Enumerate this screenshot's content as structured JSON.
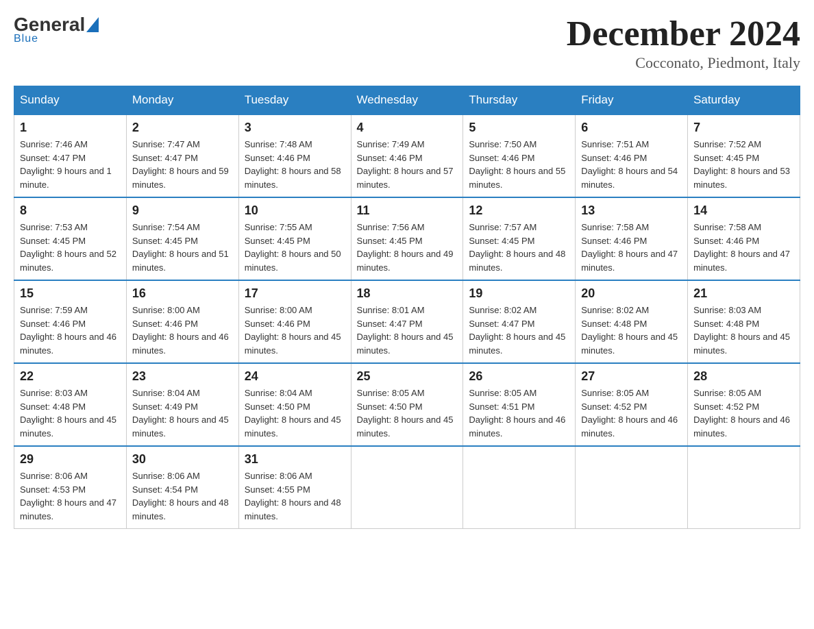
{
  "logo": {
    "general": "General",
    "blue": "Blue",
    "underline": "Blue"
  },
  "header": {
    "title": "December 2024",
    "location": "Cocconato, Piedmont, Italy"
  },
  "days_of_week": [
    "Sunday",
    "Monday",
    "Tuesday",
    "Wednesday",
    "Thursday",
    "Friday",
    "Saturday"
  ],
  "weeks": [
    [
      {
        "num": "1",
        "sunrise": "7:46 AM",
        "sunset": "4:47 PM",
        "daylight": "9 hours and 1 minute."
      },
      {
        "num": "2",
        "sunrise": "7:47 AM",
        "sunset": "4:47 PM",
        "daylight": "8 hours and 59 minutes."
      },
      {
        "num": "3",
        "sunrise": "7:48 AM",
        "sunset": "4:46 PM",
        "daylight": "8 hours and 58 minutes."
      },
      {
        "num": "4",
        "sunrise": "7:49 AM",
        "sunset": "4:46 PM",
        "daylight": "8 hours and 57 minutes."
      },
      {
        "num": "5",
        "sunrise": "7:50 AM",
        "sunset": "4:46 PM",
        "daylight": "8 hours and 55 minutes."
      },
      {
        "num": "6",
        "sunrise": "7:51 AM",
        "sunset": "4:46 PM",
        "daylight": "8 hours and 54 minutes."
      },
      {
        "num": "7",
        "sunrise": "7:52 AM",
        "sunset": "4:45 PM",
        "daylight": "8 hours and 53 minutes."
      }
    ],
    [
      {
        "num": "8",
        "sunrise": "7:53 AM",
        "sunset": "4:45 PM",
        "daylight": "8 hours and 52 minutes."
      },
      {
        "num": "9",
        "sunrise": "7:54 AM",
        "sunset": "4:45 PM",
        "daylight": "8 hours and 51 minutes."
      },
      {
        "num": "10",
        "sunrise": "7:55 AM",
        "sunset": "4:45 PM",
        "daylight": "8 hours and 50 minutes."
      },
      {
        "num": "11",
        "sunrise": "7:56 AM",
        "sunset": "4:45 PM",
        "daylight": "8 hours and 49 minutes."
      },
      {
        "num": "12",
        "sunrise": "7:57 AM",
        "sunset": "4:45 PM",
        "daylight": "8 hours and 48 minutes."
      },
      {
        "num": "13",
        "sunrise": "7:58 AM",
        "sunset": "4:46 PM",
        "daylight": "8 hours and 47 minutes."
      },
      {
        "num": "14",
        "sunrise": "7:58 AM",
        "sunset": "4:46 PM",
        "daylight": "8 hours and 47 minutes."
      }
    ],
    [
      {
        "num": "15",
        "sunrise": "7:59 AM",
        "sunset": "4:46 PM",
        "daylight": "8 hours and 46 minutes."
      },
      {
        "num": "16",
        "sunrise": "8:00 AM",
        "sunset": "4:46 PM",
        "daylight": "8 hours and 46 minutes."
      },
      {
        "num": "17",
        "sunrise": "8:00 AM",
        "sunset": "4:46 PM",
        "daylight": "8 hours and 45 minutes."
      },
      {
        "num": "18",
        "sunrise": "8:01 AM",
        "sunset": "4:47 PM",
        "daylight": "8 hours and 45 minutes."
      },
      {
        "num": "19",
        "sunrise": "8:02 AM",
        "sunset": "4:47 PM",
        "daylight": "8 hours and 45 minutes."
      },
      {
        "num": "20",
        "sunrise": "8:02 AM",
        "sunset": "4:48 PM",
        "daylight": "8 hours and 45 minutes."
      },
      {
        "num": "21",
        "sunrise": "8:03 AM",
        "sunset": "4:48 PM",
        "daylight": "8 hours and 45 minutes."
      }
    ],
    [
      {
        "num": "22",
        "sunrise": "8:03 AM",
        "sunset": "4:48 PM",
        "daylight": "8 hours and 45 minutes."
      },
      {
        "num": "23",
        "sunrise": "8:04 AM",
        "sunset": "4:49 PM",
        "daylight": "8 hours and 45 minutes."
      },
      {
        "num": "24",
        "sunrise": "8:04 AM",
        "sunset": "4:50 PM",
        "daylight": "8 hours and 45 minutes."
      },
      {
        "num": "25",
        "sunrise": "8:05 AM",
        "sunset": "4:50 PM",
        "daylight": "8 hours and 45 minutes."
      },
      {
        "num": "26",
        "sunrise": "8:05 AM",
        "sunset": "4:51 PM",
        "daylight": "8 hours and 46 minutes."
      },
      {
        "num": "27",
        "sunrise": "8:05 AM",
        "sunset": "4:52 PM",
        "daylight": "8 hours and 46 minutes."
      },
      {
        "num": "28",
        "sunrise": "8:05 AM",
        "sunset": "4:52 PM",
        "daylight": "8 hours and 46 minutes."
      }
    ],
    [
      {
        "num": "29",
        "sunrise": "8:06 AM",
        "sunset": "4:53 PM",
        "daylight": "8 hours and 47 minutes."
      },
      {
        "num": "30",
        "sunrise": "8:06 AM",
        "sunset": "4:54 PM",
        "daylight": "8 hours and 48 minutes."
      },
      {
        "num": "31",
        "sunrise": "8:06 AM",
        "sunset": "4:55 PM",
        "daylight": "8 hours and 48 minutes."
      },
      null,
      null,
      null,
      null
    ]
  ]
}
